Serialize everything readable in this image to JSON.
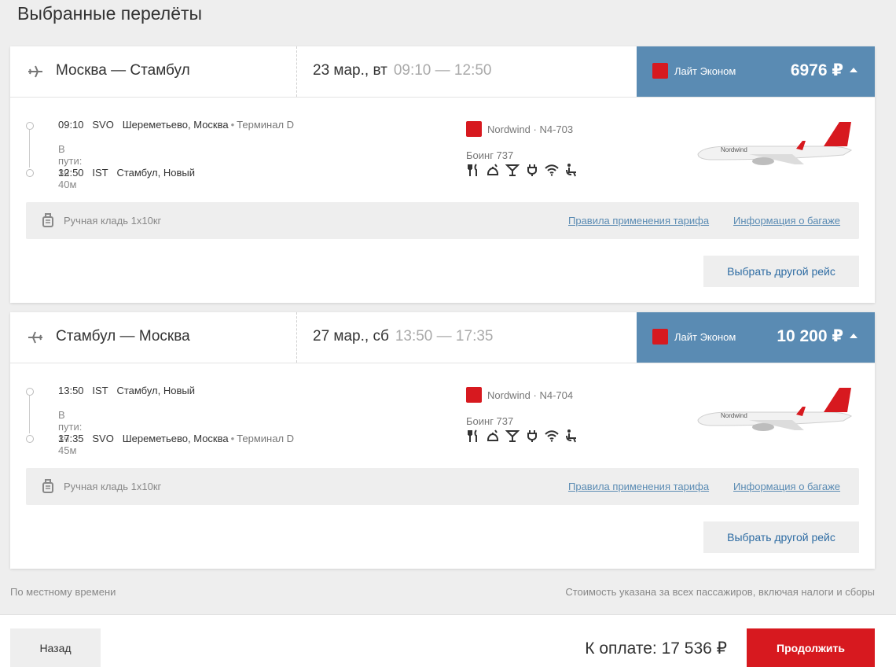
{
  "page": {
    "title": "Выбранные перелёты"
  },
  "flights": [
    {
      "route": "Москва — Стамбул",
      "date": "23 мар., вт",
      "times": "09:10 — 12:50",
      "fare": {
        "name": "Лайт Эконом",
        "price": "6976 ₽"
      },
      "departure": {
        "time": "09:10",
        "code": "SVO",
        "airport": "Шереметьево, Москва",
        "terminal": "Терминал D"
      },
      "duration": "В пути: 3ч 40м",
      "arrival": {
        "time": "12:50",
        "code": "IST",
        "airport": "Стамбул, Новый",
        "terminal": ""
      },
      "carrier": "Nordwind · N4-703",
      "aircraft": "Боинг 737",
      "baggage": "Ручная кладь 1x10кг",
      "rules_link": "Правила применения тарифа",
      "baggage_link": "Информация о багаже",
      "other_button": "Выбрать другой рейс"
    },
    {
      "route": "Стамбул — Москва",
      "date": "27 мар., сб",
      "times": "13:50 — 17:35",
      "fare": {
        "name": "Лайт Эконом",
        "price": "10 200 ₽"
      },
      "departure": {
        "time": "13:50",
        "code": "IST",
        "airport": "Стамбул, Новый",
        "terminal": ""
      },
      "duration": "В пути: 3ч 45м",
      "arrival": {
        "time": "17:35",
        "code": "SVO",
        "airport": "Шереметьево, Москва",
        "terminal": "Терминал D"
      },
      "carrier": "Nordwind · N4-704",
      "aircraft": "Боинг 737",
      "baggage": "Ручная кладь 1x10кг",
      "rules_link": "Правила применения тарифа",
      "baggage_link": "Информация о багаже",
      "other_button": "Выбрать другой рейс"
    }
  ],
  "notes": {
    "local_time": "По местному времени",
    "price_note": "Стоимость указана за всех пассажиров, включая налоги и сборы"
  },
  "footer": {
    "back": "Назад",
    "total": "К оплате: 17 536 ₽",
    "continue": "Продолжить"
  },
  "colors": {
    "accent_blue": "#5a8bb3",
    "brand_red": "#d7191f",
    "background": "#eeeeee"
  },
  "amenity_icons": [
    "meal-icon",
    "hot-meal-icon",
    "drinks-icon",
    "power-icon",
    "wifi-icon",
    "seat-icon"
  ]
}
